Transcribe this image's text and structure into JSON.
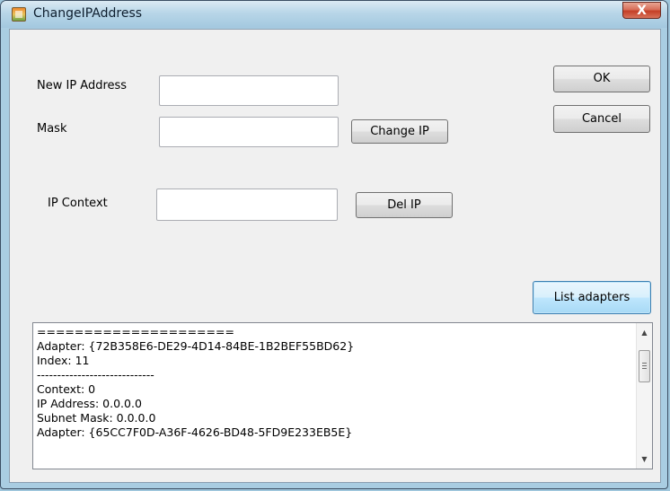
{
  "window": {
    "title": "ChangeIPAddress",
    "close_glyph": "X",
    "icon": "app-icon"
  },
  "form": {
    "new_ip_label": "New IP Address",
    "new_ip_value": "",
    "mask_label": "Mask",
    "mask_value": "",
    "ip_context_label": "IP Context",
    "ip_context_value": ""
  },
  "buttons": {
    "ok": "OK",
    "cancel": "Cancel",
    "change_ip": "Change IP",
    "del_ip": "Del IP",
    "list_adapters": "List adapters"
  },
  "output_lines": [
    "=====================",
    "Adapter: {72B358E6-DE29-4D14-84BE-1B2BEF55BD62}",
    "Index: 11",
    "-----------------------------",
    "Context: 0",
    "IP Address: 0.0.0.0",
    "Subnet Mask: 0.0.0.0",
    "Adapter: {65CC7F0D-A36F-4626-BD48-5FD9E233EB5E}"
  ],
  "scrollbar": {
    "up_glyph": "▲",
    "down_glyph": "▼"
  },
  "colors": {
    "desktop": "#9fc6dc",
    "dialog_bg": "#f0f0f0",
    "default_button_border": "#3c7fb1",
    "close_button": "#c43f26"
  }
}
